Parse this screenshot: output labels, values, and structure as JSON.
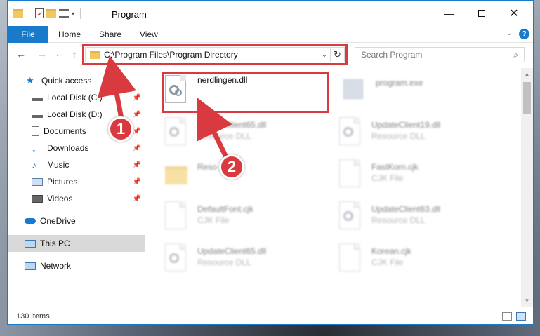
{
  "window": {
    "title": "Program"
  },
  "ribbon": {
    "tabs": [
      {
        "label": "File"
      },
      {
        "label": "Home"
      },
      {
        "label": "Share"
      },
      {
        "label": "View"
      }
    ]
  },
  "address": {
    "path": "C:\\Program Files\\Program Directory",
    "search_placeholder": "Search Program"
  },
  "nav": {
    "items": [
      {
        "label": "Quick access"
      },
      {
        "label": "Local Disk (C:)"
      },
      {
        "label": "Local Disk (D:)"
      },
      {
        "label": "Documents"
      },
      {
        "label": "Downloads"
      },
      {
        "label": "Music"
      },
      {
        "label": "Pictures"
      },
      {
        "label": "Videos"
      },
      {
        "label": "OneDrive"
      },
      {
        "label": "This PC"
      },
      {
        "label": "Network"
      }
    ]
  },
  "files": {
    "highlighted": {
      "name": "nerdlingen.dll"
    },
    "items": [
      {
        "name": "program.exe",
        "type": ""
      },
      {
        "name": "UpdateClient65.dll",
        "type": "Resource DLL"
      },
      {
        "name": "UpdateClient19.dll",
        "type": "Resource DLL"
      },
      {
        "name": "Reso",
        "type": ""
      },
      {
        "name": "FastKorn.cjk",
        "type": "CJK File"
      },
      {
        "name": "DefaultFont.cjk",
        "type": "CJK File"
      },
      {
        "name": "UpdateClient63.dll",
        "type": "Resource DLL"
      },
      {
        "name": "UpdateClient65.dll",
        "type": "Resource DLL"
      },
      {
        "name": "Korean.cjk",
        "type": "CJK File"
      }
    ]
  },
  "status": {
    "count": "130 items"
  },
  "annotations": {
    "badge1": "1",
    "badge2": "2",
    "accent_color": "#d83a3f"
  }
}
